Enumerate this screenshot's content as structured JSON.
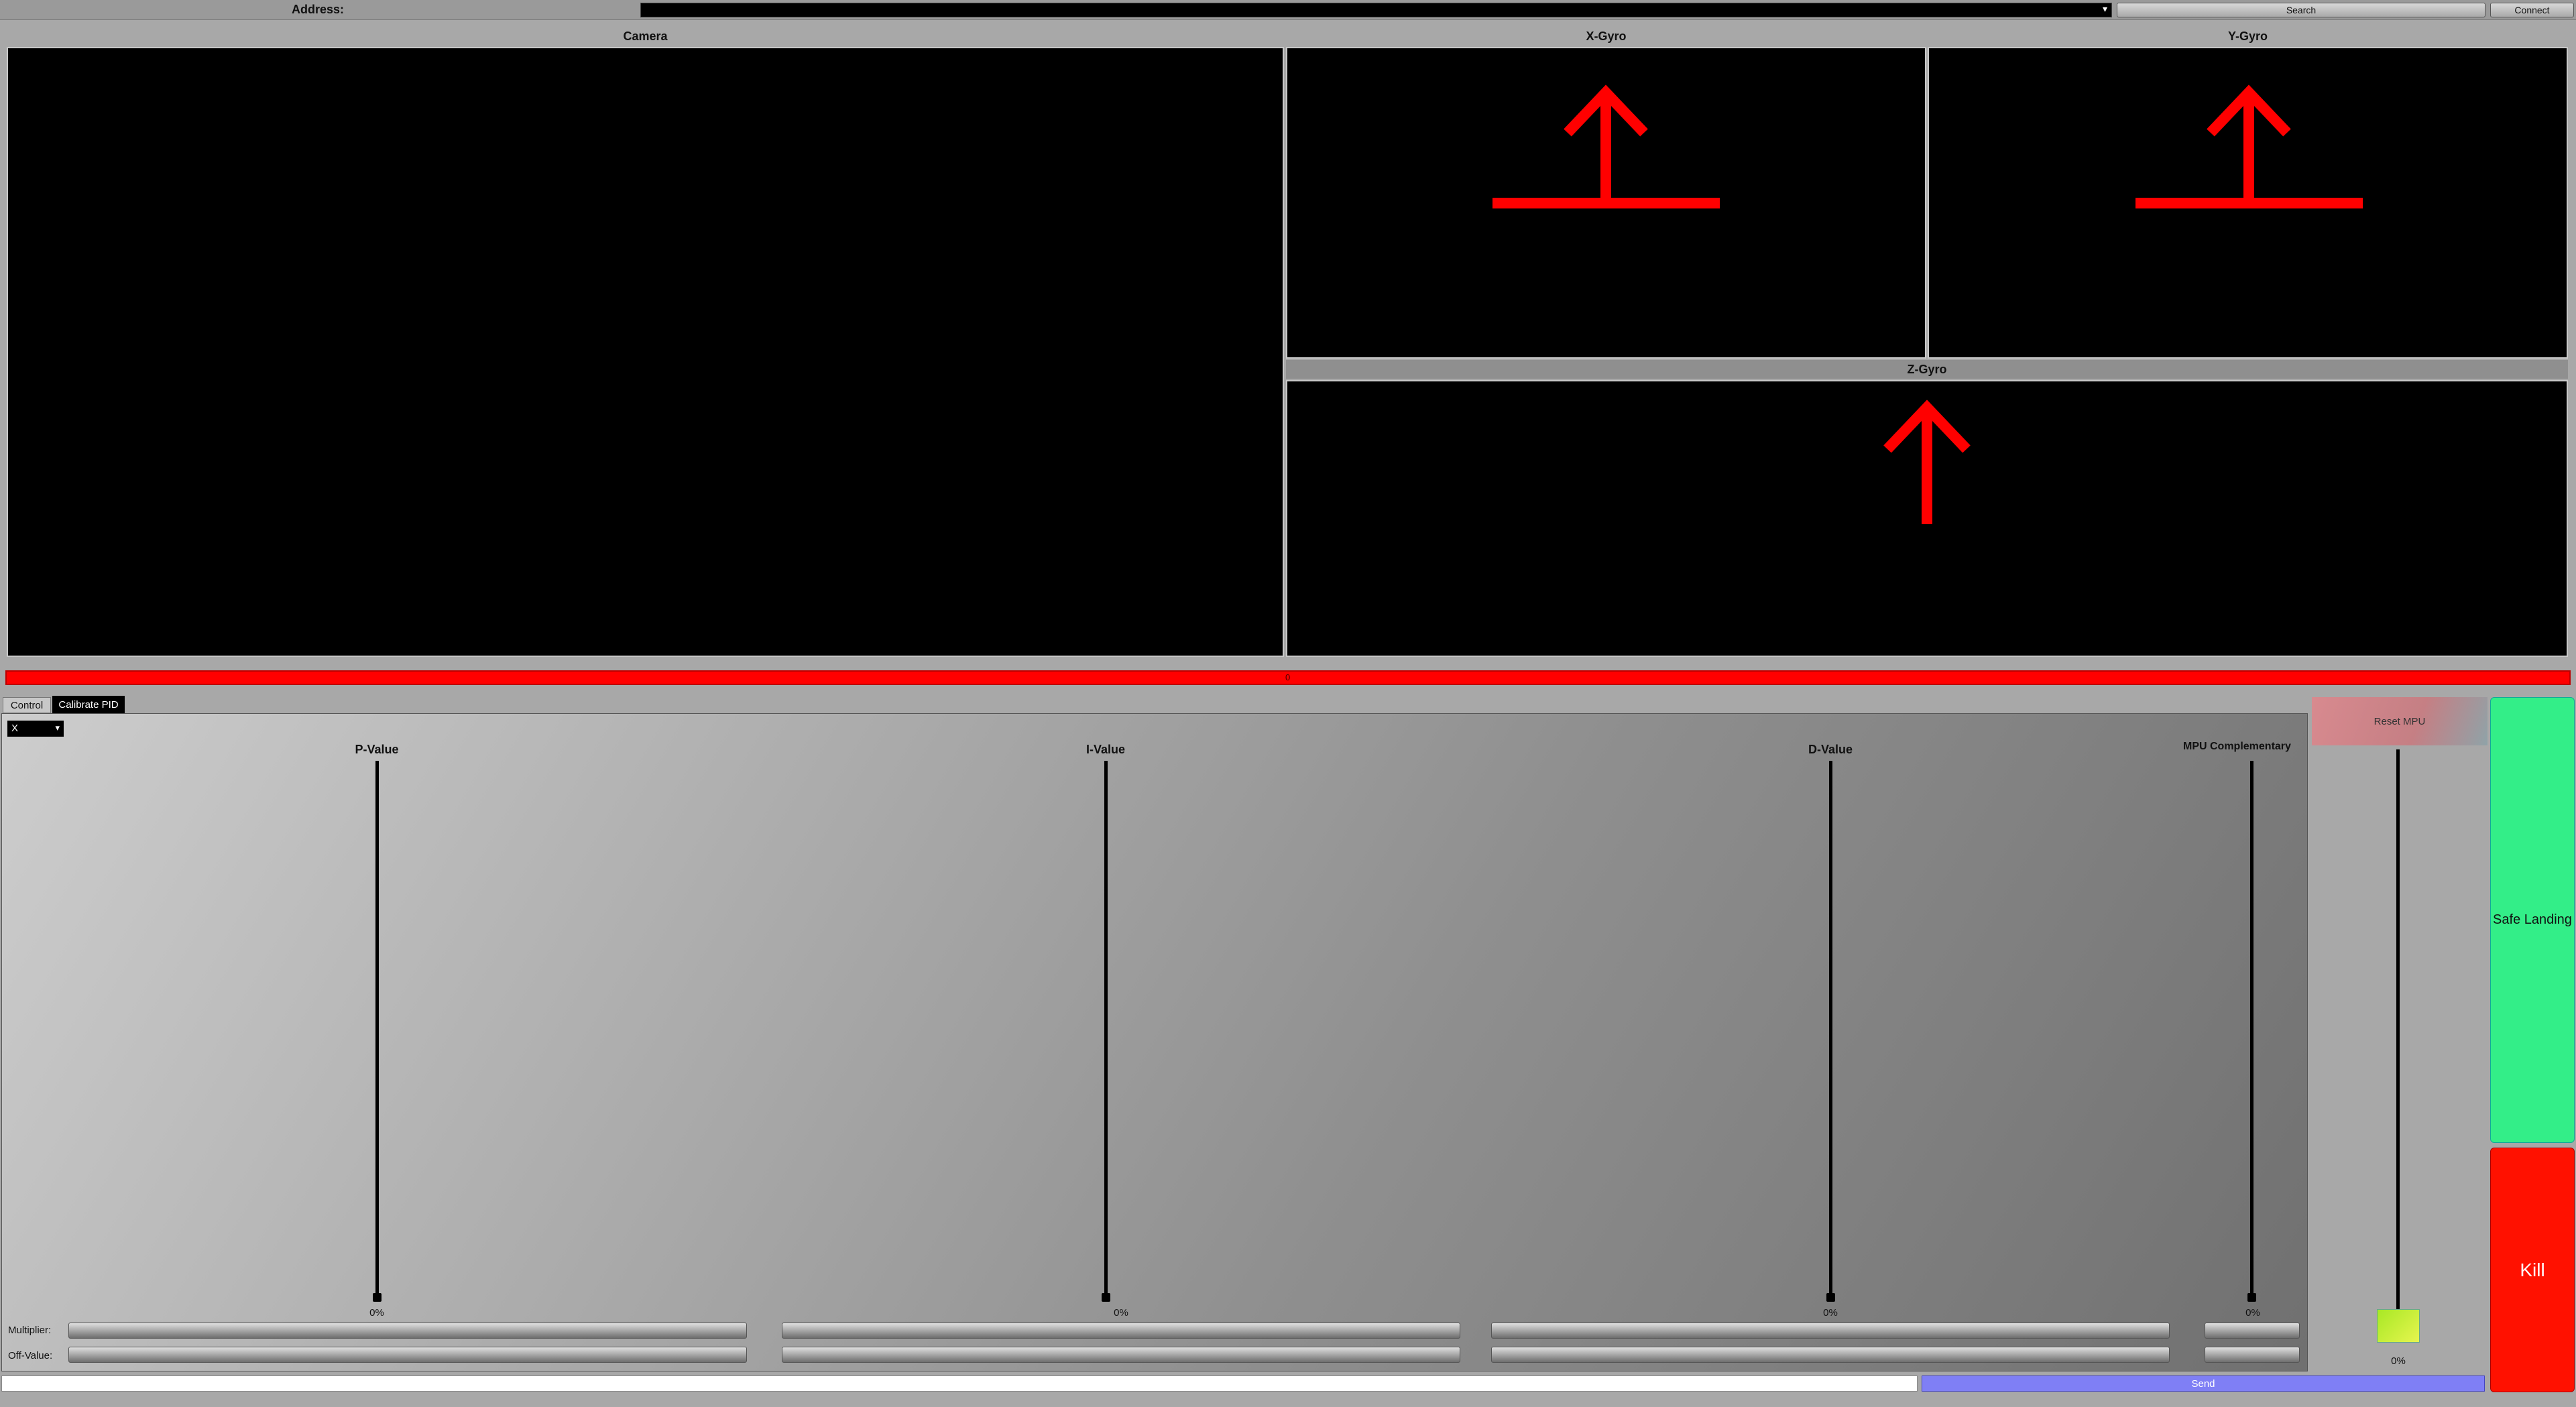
{
  "address_bar": {
    "label": "Address:",
    "value": "",
    "search_label": "Search",
    "connect_label": "Connect"
  },
  "panels": {
    "camera_title": "Camera",
    "x_gyro_title": "X-Gyro",
    "y_gyro_title": "Y-Gyro",
    "z_gyro_title": "Z-Gyro"
  },
  "status_bar": {
    "color": "#ff0000",
    "marker": "0"
  },
  "tabs": [
    {
      "label": "Control",
      "active": false
    },
    {
      "label": "Calibrate PID",
      "active": true
    }
  ],
  "axis_select": {
    "value": "X"
  },
  "sliders": {
    "p": {
      "title": "P-Value",
      "value_label": "0%"
    },
    "i": {
      "title": "I-Value",
      "value_label": "0%"
    },
    "d": {
      "title": "D-Value",
      "value_label": "0%"
    },
    "mpu": {
      "title": "MPU Complementary",
      "value_label": "0%"
    }
  },
  "rows": {
    "multiplier_label": "Multiplier:",
    "offvalue_label": "Off-Value:"
  },
  "side": {
    "reset_mpu_label": "Reset MPU",
    "throttle_label": "0%",
    "safe_landing_label": "Safe Landing",
    "kill_label": "Kill"
  },
  "send_bar": {
    "input_value": "",
    "send_label": "Send"
  },
  "colors": {
    "arrow": "#ff0000",
    "safe_landing": "#33ee88",
    "kill": "#ff1100",
    "send": "#7f7ff5"
  }
}
